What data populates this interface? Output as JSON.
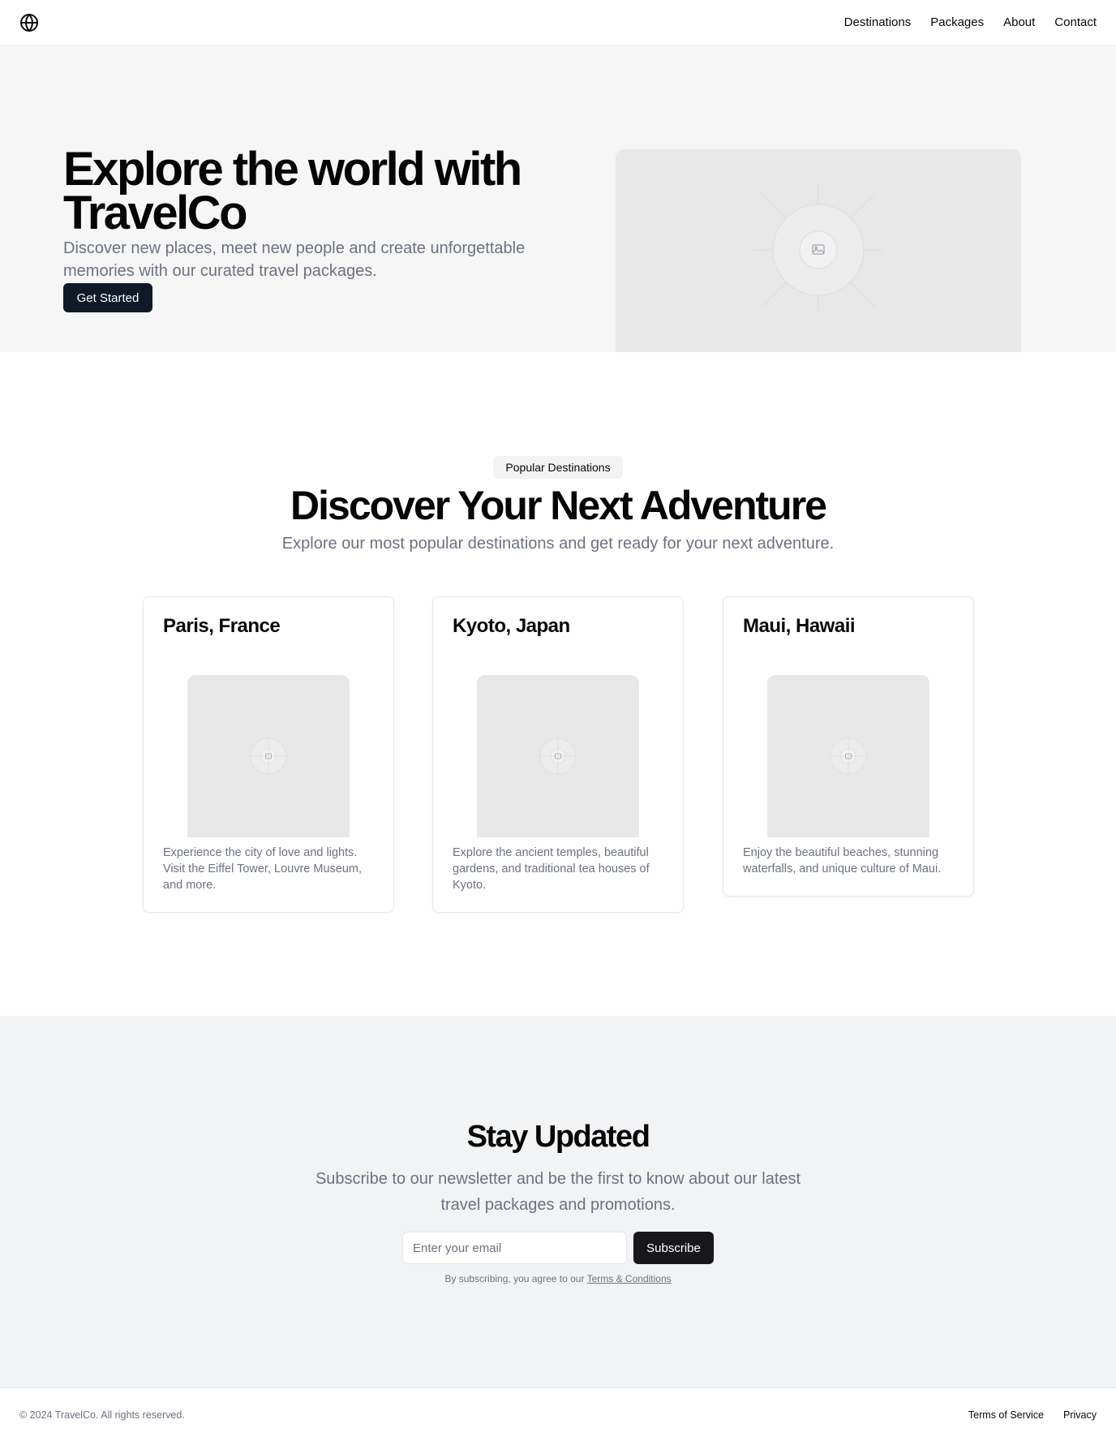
{
  "header": {
    "logo_icon": "globe-icon",
    "nav": [
      {
        "label": "Destinations"
      },
      {
        "label": "Packages"
      },
      {
        "label": "About"
      },
      {
        "label": "Contact"
      }
    ]
  },
  "hero": {
    "title": "Explore the world with TravelCo",
    "description": "Discover new places, meet new people and create unforgettable memories with our curated travel packages.",
    "cta_label": "Get Started",
    "image_icon": "image-placeholder-icon"
  },
  "destinations": {
    "badge": "Popular Destinations",
    "title": "Discover Your Next Adventure",
    "subtitle": "Explore our most popular destinations and get ready for your next adventure.",
    "cards": [
      {
        "title": "Paris, France",
        "description": "Experience the city of love and lights. Visit the Eiffel Tower, Louvre Museum, and more."
      },
      {
        "title": "Kyoto, Japan",
        "description": "Explore the ancient temples, beautiful gardens, and traditional tea houses of Kyoto."
      },
      {
        "title": "Maui, Hawaii",
        "description": "Enjoy the beautiful beaches, stunning waterfalls, and unique culture of Maui."
      }
    ]
  },
  "newsletter": {
    "title": "Stay Updated",
    "description": "Subscribe to our newsletter and be the first to know about our latest travel packages and promotions.",
    "email_placeholder": "Enter your email",
    "email_value": "",
    "subscribe_label": "Subscribe",
    "note_prefix": "By subscribing, you agree to our",
    "note_link": "Terms & Conditions"
  },
  "footer": {
    "copyright": "© 2024 TravelCo. All rights reserved.",
    "links": [
      {
        "label": "Terms of Service"
      },
      {
        "label": "Privacy"
      }
    ]
  },
  "colors": {
    "primary_button": "#111827",
    "hero_background": "#f6f6f6",
    "newsletter_background": "#f2f3f5",
    "muted_text": "#6b7280",
    "placeholder_image": "#e8e8e8"
  }
}
